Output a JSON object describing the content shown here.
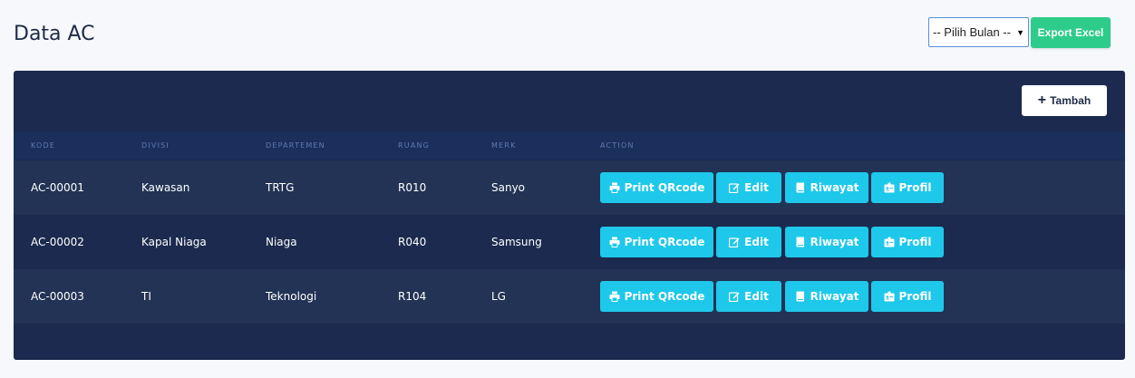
{
  "header": {
    "title": "Data AC",
    "month_select": "-- Pilih Bulan --",
    "export_label": "Export Excel"
  },
  "card": {
    "add_label": "Tambah"
  },
  "table": {
    "columns": [
      "KODE",
      "DIVISI",
      "DEPARTEMEN",
      "RUANG",
      "MERK",
      "ACTION"
    ],
    "rows": [
      {
        "kode": "AC-00001",
        "divisi": "Kawasan",
        "departemen": "TRTG",
        "ruang": "R010",
        "merk": "Sanyo"
      },
      {
        "kode": "AC-00002",
        "divisi": "Kapal Niaga",
        "departemen": "Niaga",
        "ruang": "R040",
        "merk": "Samsung"
      },
      {
        "kode": "AC-00003",
        "divisi": "TI",
        "departemen": "Teknologi",
        "ruang": "R104",
        "merk": "LG"
      }
    ],
    "actions": {
      "print": "Print QRcode",
      "edit": "Edit",
      "riwayat": "Riwayat",
      "profil": "Profil"
    }
  },
  "colors": {
    "card_bg": "#1b2a4e",
    "row_alt": "#223355",
    "accent_cyan": "#1ec8ea",
    "export_green": "#2ecc8a"
  },
  "icons": {
    "print": "printer-icon",
    "edit": "edit-icon",
    "riwayat": "book-icon",
    "profil": "id-card-icon",
    "add": "plus-icon"
  }
}
